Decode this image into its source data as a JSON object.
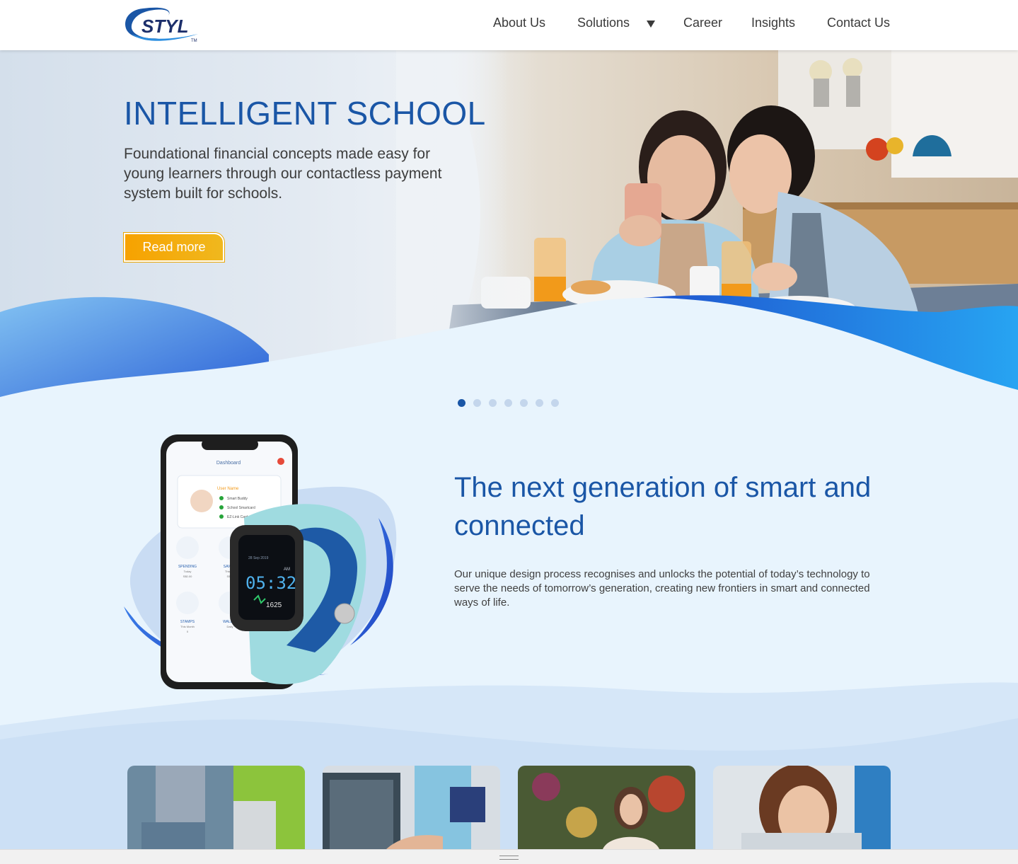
{
  "brand": {
    "logo_text": "STYL",
    "logo_mark": "TM",
    "primary_color": "#1a56a6",
    "accent_color": "#f7a200"
  },
  "nav": {
    "about": "About Us",
    "solutions": "Solutions",
    "career": "Career",
    "insights": "Insights",
    "contact": "Contact Us"
  },
  "hero": {
    "title": "INTELLIGENT SCHOOL",
    "text": "Foundational financial concepts made easy for young learners through our contactless payment system built for schools.",
    "button": "Read more"
  },
  "carousel": {
    "slide_count": 7,
    "active_index": 0
  },
  "product": {
    "app_title": "Dashboard",
    "user_name": "User Name",
    "linked_items": [
      "Smart Buddy",
      "School Smartcard",
      "EZ-Link Card"
    ],
    "tiles": [
      "SPENDING",
      "SAVING",
      "STAMPS",
      "WALLET"
    ],
    "tile_sub": [
      "Today",
      "This Mo",
      "This Month",
      "Daily"
    ],
    "tile_values": [
      "S$0.00",
      "S$xx",
      "0",
      ""
    ],
    "watch_date": "28 Sep 2019",
    "watch_ampm": "AM",
    "watch_time": "05:32",
    "watch_steps": "1625"
  },
  "section": {
    "title": "The next generation of smart and connected",
    "text": "Our unique design process recognises and unlocks the potential of today’s technology to serve the needs of tomorrow’s generation, creating new frontiers in smart and connected ways of life."
  },
  "cards": [
    {
      "icon": "photo-shopping"
    },
    {
      "icon": "photo-kiosk"
    },
    {
      "icon": "photo-florist"
    },
    {
      "icon": "photo-student"
    }
  ]
}
